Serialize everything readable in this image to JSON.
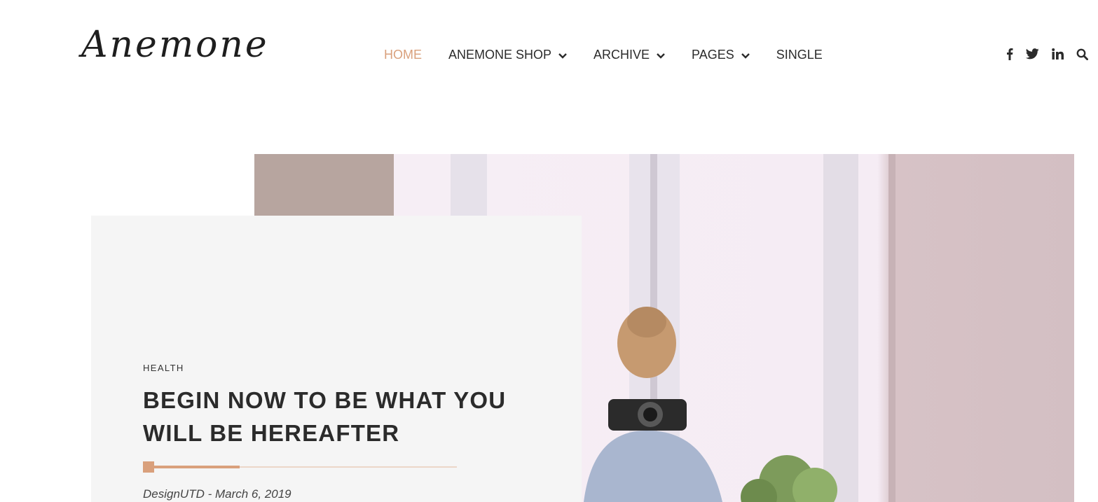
{
  "header": {
    "logo_text": "Anemone",
    "nav": [
      {
        "label": "HOME",
        "active": true,
        "has_dropdown": false
      },
      {
        "label": "ANEMONE SHOP",
        "active": false,
        "has_dropdown": true
      },
      {
        "label": "ARCHIVE",
        "active": false,
        "has_dropdown": true
      },
      {
        "label": "PAGES",
        "active": false,
        "has_dropdown": true
      },
      {
        "label": "SINGLE",
        "active": false,
        "has_dropdown": false
      }
    ],
    "social_icons": [
      "facebook-icon",
      "twitter-icon",
      "linkedin-icon",
      "search-icon"
    ]
  },
  "hero": {
    "image_subject": "woman-holding-camera-by-window",
    "category": "HEALTH",
    "title_lines": [
      "BEGIN NOW TO BE WHAT YOU",
      "WILL BE HEREAFTER"
    ],
    "meta": "DesignUTD - March 6, 2019"
  },
  "colors": {
    "accent": "#d9a07c",
    "text": "#2b2b2b",
    "card_bg": "#f5f5f5"
  }
}
